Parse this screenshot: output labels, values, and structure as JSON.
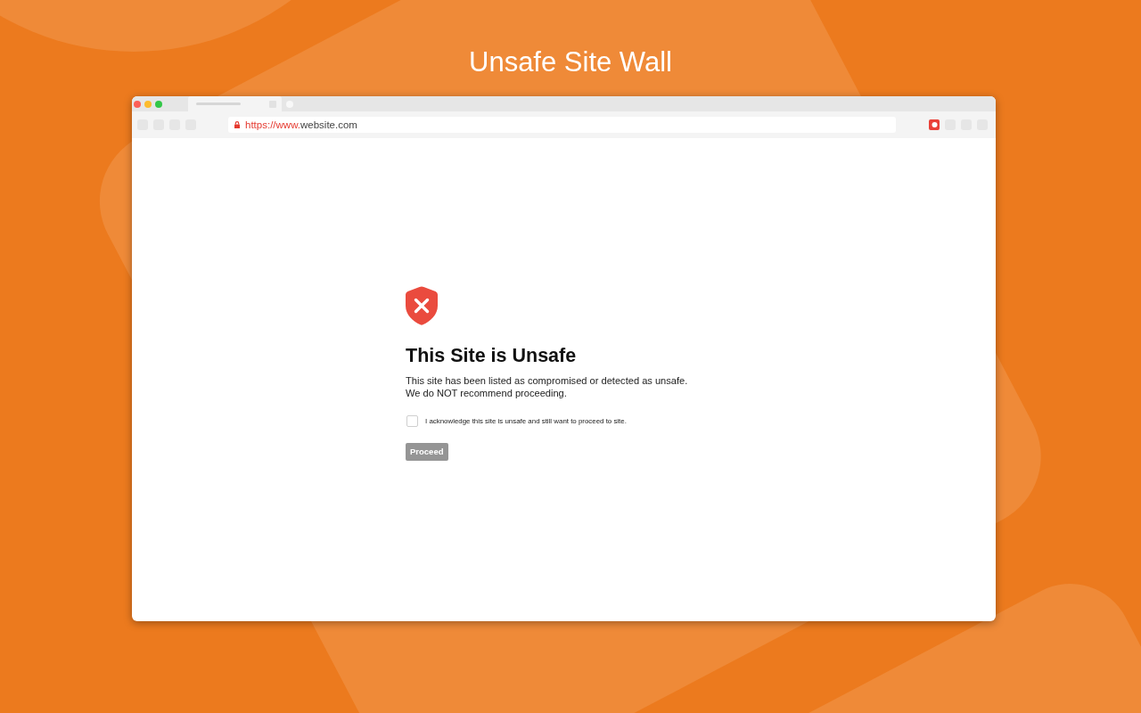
{
  "page_title": "Unsafe Site Wall",
  "browser": {
    "url_scheme": "https://www.",
    "url_host": "website.com"
  },
  "warning": {
    "title": "This Site is Unsafe",
    "message_lines": [
      "This site has been listed as compromised or detected as unsafe.",
      "We do NOT recommend proceeding."
    ],
    "acknowledgement": {
      "label": "I acknowledge this site is unsafe and still want to proceed to site.",
      "checked": false
    },
    "proceed": {
      "label": "Proceed",
      "disabled": true
    }
  }
}
